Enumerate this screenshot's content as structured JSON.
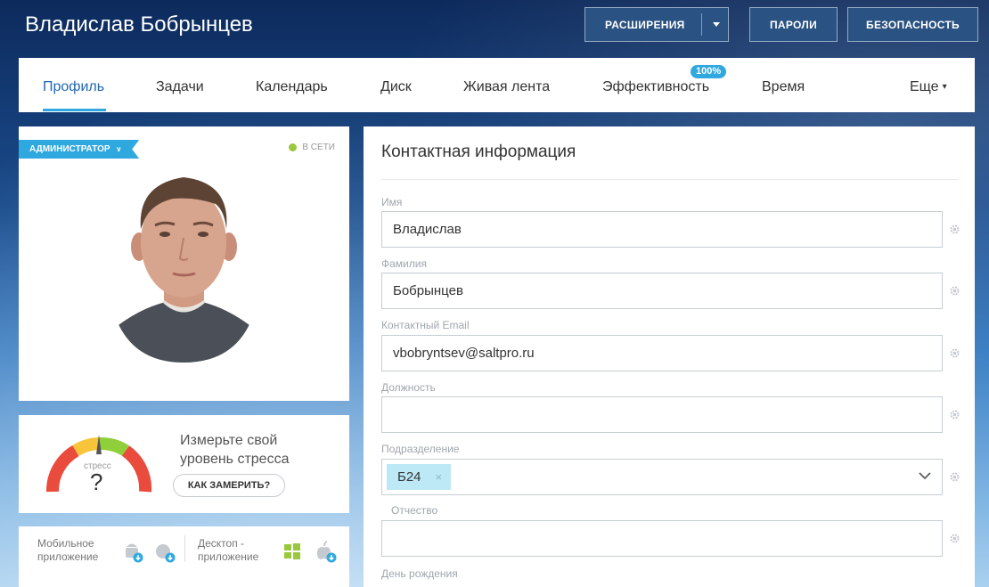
{
  "header": {
    "title": "Владислав Бобрынцев",
    "buttons": {
      "extensions": "РАСШИРЕНИЯ",
      "passwords": "ПАРОЛИ",
      "security": "БЕЗОПАСНОСТЬ"
    }
  },
  "tabs": {
    "items": [
      {
        "label": "Профиль"
      },
      {
        "label": "Задачи"
      },
      {
        "label": "Календарь"
      },
      {
        "label": "Диск"
      },
      {
        "label": "Живая лента"
      },
      {
        "label": "Эффективность"
      },
      {
        "label": "Время"
      },
      {
        "label": "Еще"
      }
    ],
    "efficiency_badge": "100%",
    "active_index": 0
  },
  "profile": {
    "role_tag": "АДМИНИСТРАТОР",
    "status": "В СЕТИ",
    "status_color": "#9bc73d"
  },
  "stress": {
    "gauge_label": "стресс",
    "gauge_value": "?",
    "headline": "Измерьте свой уровень стресса",
    "button": "КАК ЗАМЕРИТЬ?"
  },
  "apps": {
    "mobile_label": "Мобильное приложение",
    "desktop_label": "Десктоп - приложение",
    "mobile_icons": [
      "android-download-icon",
      "globe-download-icon"
    ],
    "desktop_icons": [
      "windows-icon",
      "apple-download-icon"
    ]
  },
  "form": {
    "title": "Контактная информация",
    "fields": {
      "first_name": {
        "label": "Имя",
        "value": "Владислав"
      },
      "last_name": {
        "label": "Фамилия",
        "value": "Бобрынцев"
      },
      "email": {
        "label": "Контактный Email",
        "value": "vbobryntsev@saltpro.ru"
      },
      "position": {
        "label": "Должность",
        "value": ""
      },
      "department": {
        "label": "Подразделение",
        "selected": "Б24",
        "remove": "×"
      },
      "patronymic": {
        "label": "Отчество",
        "value": ""
      },
      "birthday": {
        "label": "День рождения"
      }
    }
  },
  "colors": {
    "accent": "#2fa8e0",
    "active_tab": "#2067b0",
    "header_button": "#2a5282"
  }
}
